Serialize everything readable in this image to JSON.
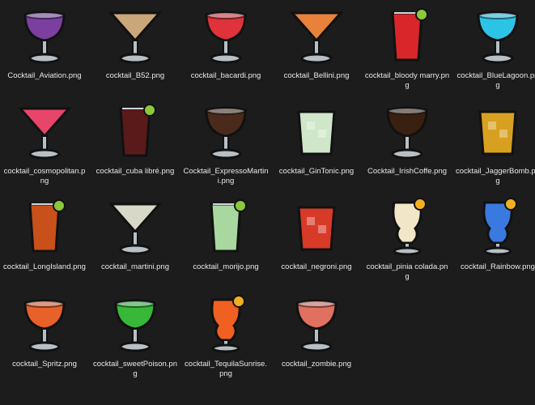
{
  "files": [
    {
      "label": "Cocktail_Aviation.png",
      "icon": "cocktail-aviation-icon",
      "liquid": "#7b3fa0",
      "glass": "coupe"
    },
    {
      "label": "cocktail_B52.png",
      "icon": "cocktail-b52-icon",
      "liquid": "#caa77a",
      "glass": "martini"
    },
    {
      "label": "cocktail_bacardi.png",
      "icon": "cocktail-bacardi-icon",
      "liquid": "#e0323a",
      "glass": "coupe"
    },
    {
      "label": "cocktail_Bellini.png",
      "icon": "cocktail-bellini-icon",
      "liquid": "#e8823a",
      "glass": "martini"
    },
    {
      "label": "cocktail_bloody marry.png",
      "icon": "cocktail-bloody-marry-icon",
      "liquid": "#d8262a",
      "glass": "tall"
    },
    {
      "label": "cocktail_BlueLagoon.png",
      "icon": "cocktail-blue-lagoon-icon",
      "liquid": "#2cc4e6",
      "glass": "coupe"
    },
    {
      "label": "cocktail_cosmopolitan.png",
      "icon": "cocktail-cosmopolitan-icon",
      "liquid": "#e8456a",
      "glass": "martini"
    },
    {
      "label": "cocktail_cuba libré.png",
      "icon": "cocktail-cuba-libre-icon",
      "liquid": "#5a1a1a",
      "glass": "tall"
    },
    {
      "label": "Cocktail_ExpressoMartini.png",
      "icon": "cocktail-expresso-martini-icon",
      "liquid": "#4a2a1a",
      "glass": "coupe"
    },
    {
      "label": "cocktail_GinTonic.png",
      "icon": "cocktail-gin-tonic-icon",
      "liquid": "#cfe6c8",
      "glass": "tumbler"
    },
    {
      "label": "Cocktail_IrishCoffe.png",
      "icon": "cocktail-irish-coffee-icon",
      "liquid": "#3a2010",
      "glass": "coupe"
    },
    {
      "label": "cocktail_JaggerBomb.png",
      "icon": "cocktail-jagger-bomb-icon",
      "liquid": "#d8a020",
      "glass": "tumbler"
    },
    {
      "label": "cocktail_LongIsland.png",
      "icon": "cocktail-long-island-icon",
      "liquid": "#c8501a",
      "glass": "tall"
    },
    {
      "label": "cocktail_martini.png",
      "icon": "cocktail-martini-icon",
      "liquid": "#d8d8c8",
      "glass": "martini"
    },
    {
      "label": "cocktail_morijo.png",
      "icon": "cocktail-mojito-icon",
      "liquid": "#a8d8a0",
      "glass": "tall"
    },
    {
      "label": "cocktail_negroni.png",
      "icon": "cocktail-negroni-icon",
      "liquid": "#d83a28",
      "glass": "tumbler"
    },
    {
      "label": "cocktail_pinia colada.png",
      "icon": "cocktail-pina-colada-icon",
      "liquid": "#f2e6c8",
      "glass": "hurricane"
    },
    {
      "label": "cocktail_Rainbow.png",
      "icon": "cocktail-rainbow-icon",
      "liquid": "#3a7ae0",
      "glass": "hurricane"
    },
    {
      "label": "cocktail_Spritz.png",
      "icon": "cocktail-spritz-icon",
      "liquid": "#e8602a",
      "glass": "coupe"
    },
    {
      "label": "cocktail_sweetPoison.png",
      "icon": "cocktail-sweet-poison-icon",
      "liquid": "#38b838",
      "glass": "coupe"
    },
    {
      "label": "cocktail_TequilaSunrise.png",
      "icon": "cocktail-tequila-sunrise-icon",
      "liquid": "#f06020",
      "glass": "hurricane"
    },
    {
      "label": "cocktail_zombie.png",
      "icon": "cocktail-zombie-icon",
      "liquid": "#e07060",
      "glass": "coupe"
    }
  ]
}
